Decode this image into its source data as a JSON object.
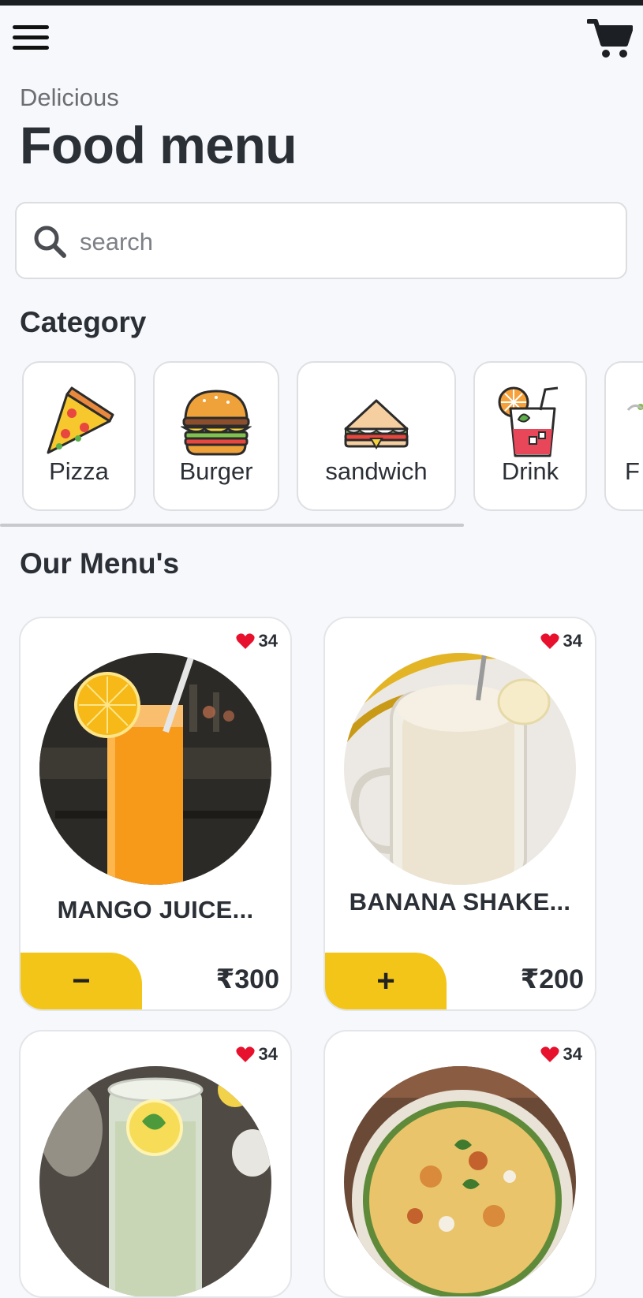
{
  "header": {
    "subtitle": "Delicious",
    "title": "Food menu",
    "menu_icon": "hamburger-menu-icon",
    "cart_icon": "cart-icon"
  },
  "search": {
    "placeholder": "search",
    "value": ""
  },
  "category_title": "Category",
  "categories": [
    {
      "label": "Pizza",
      "icon": "pizza-icon"
    },
    {
      "label": "Burger",
      "icon": "burger-icon"
    },
    {
      "label": "sandwich",
      "icon": "sandwich-icon"
    },
    {
      "label": "Drink",
      "icon": "drink-icon"
    },
    {
      "label": "F",
      "icon": "salad-icon"
    }
  ],
  "menu_title": "Our Menu's",
  "menu_items": [
    {
      "name": "MANGO JUICE...",
      "likes": "34",
      "price": "₹300",
      "action": "−"
    },
    {
      "name": "BANANA SHAKE...",
      "likes": "34",
      "price": "₹200",
      "action": "+"
    },
    {
      "name": "",
      "likes": "34",
      "price": "",
      "action": ""
    },
    {
      "name": "",
      "likes": "34",
      "price": "",
      "action": ""
    }
  ],
  "colors": {
    "accent": "#f3c518",
    "heart": "#e8112d",
    "text": "#2b2f36",
    "background": "#f7f8fb"
  }
}
